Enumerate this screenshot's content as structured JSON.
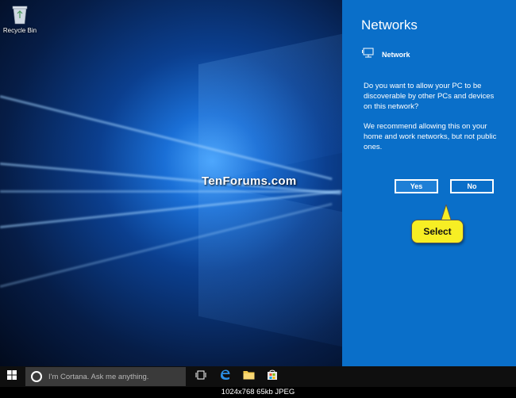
{
  "desktop": {
    "recycle_bin_label": "Recycle Bin",
    "watermark": "TenForums.com"
  },
  "network_panel": {
    "title": "Networks",
    "network_name": "Network",
    "question": "Do you want to allow your PC to be discoverable by other PCs and devices on this network?",
    "recommendation": "We recommend allowing this on your home and work networks, but not public ones.",
    "yes_label": "Yes",
    "no_label": "No",
    "callout_label": "Select",
    "colors": {
      "panel_bg": "#0a6fc9",
      "callout_bg": "#f7ee24"
    }
  },
  "taskbar": {
    "search_placeholder": "I'm Cortana. Ask me anything.",
    "icons": [
      "windows-start-icon",
      "cortana-circle-icon",
      "task-view-icon",
      "edge-icon",
      "file-explorer-icon",
      "store-icon"
    ]
  },
  "image_info": {
    "caption": "1024x768  65kb  JPEG"
  }
}
